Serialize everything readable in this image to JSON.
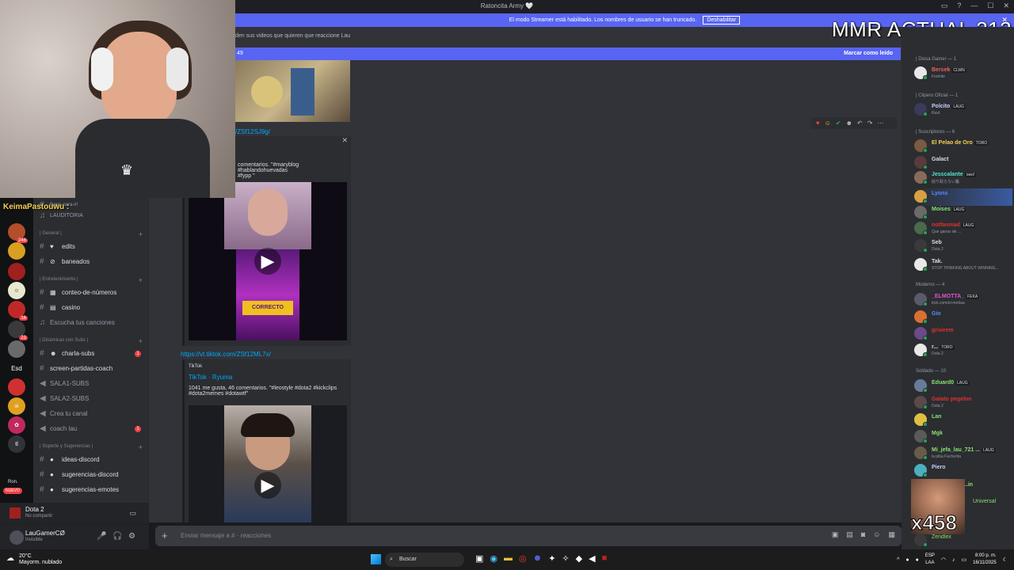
{
  "titlebar": {
    "title": "Ratoncita Army 🤍"
  },
  "banner": {
    "text": "El modo Streamer está habilitado. Los nombres de usuario se han truncado.",
    "button": "Deshabilitar"
  },
  "overlay": {
    "mmr": "MMR ACTUAL 212",
    "counter": "x458"
  },
  "voice_user": "KeimaPastouwu :",
  "channels": {
    "top_partial": "flyers-para-ir!",
    "auditoria": "LAUDITORIA",
    "cat_general": "| General |",
    "edits": "edits",
    "baneados": "baneados",
    "cat_entretenimiento": "| Entretenimiento |",
    "conteo": "conteo-de-números",
    "casino": "casino",
    "escucha": "Escucha tus canciones",
    "cat_dinamicas": "| Dinámicas con Subs |",
    "charla": "charla-subs",
    "screen": "screen-partidas-coach",
    "sala1": "SALA1-SUBS",
    "sala2": "SALA2-SUBS",
    "crea": "Crea tu canal",
    "coach": "coach lau",
    "cat_soporte": "| Soporte y Sugerencias |",
    "ideas": "ideas-discord",
    "sugerencias": "sugerencias-discord",
    "sugerencias_emotes": "sugerencias-emotes"
  },
  "servers": {
    "badge1": "246",
    "badge2": "23",
    "badge3": "16",
    "nuevo": "NUEVO",
    "esd": "Esd",
    "ron": "Ron."
  },
  "voice_status": {
    "game": "Dota 2",
    "sub": "No compartir"
  },
  "user": {
    "name": "LauGamerCØ",
    "status": "Invisible"
  },
  "chat": {
    "topic": "den sus videos que quieren que reaccione Lau",
    "newmsg_left": "49",
    "newmsg_right": "Marcar como leído",
    "link1": "/ZSf12SJ9g/",
    "embed1_text": "comentarios. \"#maryblog #hablandohuevadas\n#fypp \"",
    "link2": "https://vt.tiktok.com/ZSf12ML7x/",
    "embed2_source": "TikTok",
    "embed2_title": "TikTok · Ryuma",
    "embed2_desc": "1041 me gusta, 46 comentarios. \"#leostyle #dota2 #kickclips\n#dota2memes #dotawtf\"",
    "correcto": "CORRECTO",
    "composer": "Enviar mensaje a #",
    "composer_suffix": "reacciones"
  },
  "members": {
    "cat1": "| Diosa Gamer — 1",
    "m1": {
      "name": "Bersek",
      "tag": "CLWN",
      "status": "Fortnite"
    },
    "cat2": "| Clipero Oficial — 1",
    "m2": {
      "name": "Polcito",
      "tag": "LAUG",
      "status": "Rust"
    },
    "cat3": "| Suscriptores — 6",
    "m3": {
      "name": "El Pelao de Oro",
      "tag": "TORO"
    },
    "m4": {
      "name": "Galact"
    },
    "m5": {
      "name": "Jesscalante",
      "tag": "owo!",
      "status": "削り取らない鬣"
    },
    "m6": {
      "name": "Lyons"
    },
    "m7": {
      "name": "Moises",
      "tag": "LAUG"
    },
    "m8": {
      "name": "notfanmad",
      "tag": "LAUG",
      "status": "Que ganas de ..."
    },
    "m9": {
      "name": "Seb",
      "status": "Dota 2"
    },
    "m10": {
      "name": "Tak.",
      "status": "STOP THINKING ABOUT WINNING..."
    },
    "cat4": "Moderno — 4",
    "m11": {
      "name": "_ELMOTTA_",
      "tag": "FEKA",
      "status": "kick.com/el-mottaa"
    },
    "m12": {
      "name": "Gio"
    },
    "m13": {
      "name": "grivirem"
    },
    "m14": {
      "name": "r...",
      "tag": "TORO",
      "status": "Dota 2"
    },
    "cat5": "Soldado — 10",
    "m15": {
      "name": "Eduard0",
      "tag": "LAUG"
    },
    "m16": {
      "name": "Gaiato pegelon",
      "status": "Dota 2"
    },
    "m17": {
      "name": "Lan"
    },
    "m18": {
      "name": "Mgk"
    },
    "m19": {
      "name": "Mi_jefa_lau_721 ...",
      "tag": "LAUG",
      "status": "la piba Facherita"
    },
    "m20": {
      "name": "Piero"
    },
    "m21": {
      "name": "...in"
    },
    "m22": {
      "name": "Universal"
    },
    "m23": {
      "name": "Zendlex"
    }
  },
  "taskbar": {
    "temp": "20°C",
    "weather": "Mayorm. nublado",
    "search": "Buscar",
    "lang1": "ESP",
    "lang2": "LAA",
    "time": "8:00 p. m.",
    "date": "16/11/2025"
  }
}
